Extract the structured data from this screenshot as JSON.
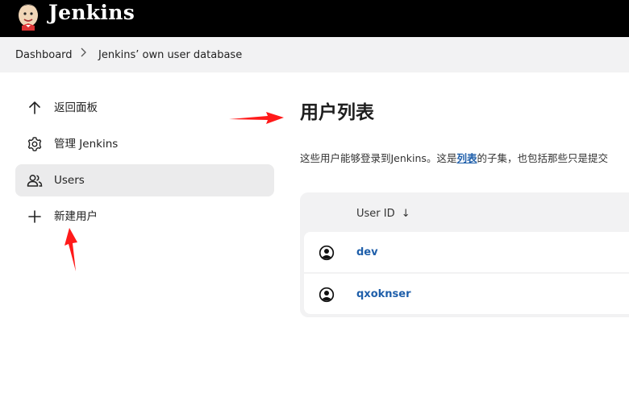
{
  "header": {
    "brand": "Jenkins",
    "logo_icon": "jenkins-butler-logo"
  },
  "breadcrumb": {
    "items": [
      "Dashboard",
      "Jenkins’ own user database"
    ]
  },
  "sidebar": {
    "items": [
      {
        "label": "返回面板",
        "icon": "arrow-up-icon",
        "active": false
      },
      {
        "label": "管理 Jenkins",
        "icon": "gear-icon",
        "active": false
      },
      {
        "label": "Users",
        "icon": "users-icon",
        "active": true
      },
      {
        "label": "新建用户",
        "icon": "plus-icon",
        "active": false
      }
    ]
  },
  "main": {
    "title": "用户列表",
    "description_prefix": "这些用户能够登录到Jenkins。这是",
    "description_link": "列表",
    "description_suffix": "的子集，也包括那些只是提交",
    "table": {
      "column_user_id": "User ID",
      "sort_indicator": "↓",
      "rows": [
        {
          "user_id": "dev"
        },
        {
          "user_id": "qxoknser"
        }
      ]
    }
  },
  "annotations": {
    "arrow_color": "#ff1a1a"
  }
}
